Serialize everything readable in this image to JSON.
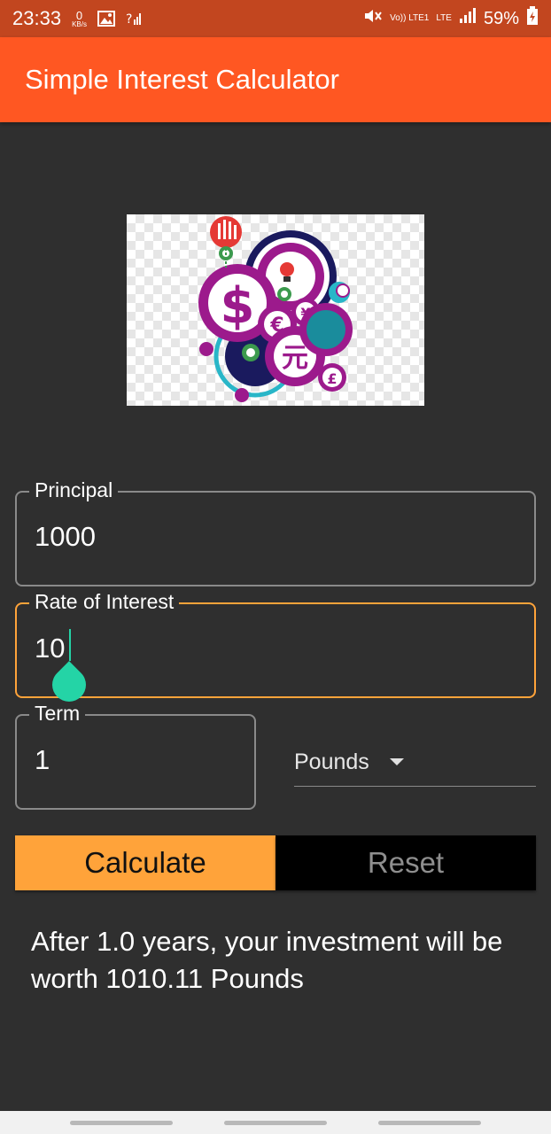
{
  "status_bar": {
    "time": "23:33",
    "speed_value": "0",
    "speed_unit": "KB/s",
    "volte_label": "Vo)) LTE1",
    "lte_label": "LTE",
    "battery_percent": "59%"
  },
  "app_bar": {
    "title": "Simple Interest Calculator"
  },
  "logo": {
    "icon": "finance-gears-currency-logo"
  },
  "principal": {
    "label": "Principal",
    "value": "1000"
  },
  "rate": {
    "label": "Rate of Interest",
    "value": "10"
  },
  "term": {
    "label": "Term",
    "value": "1"
  },
  "currency": {
    "selected": "Pounds"
  },
  "buttons": {
    "calculate": "Calculate",
    "reset": "Reset"
  },
  "result": {
    "text": "After 1.0 years, your investment will be worth 1010.11 Pounds"
  },
  "colors": {
    "accent": "#ff5722",
    "status_bar": "#c2461f",
    "focus": "#ffa33a",
    "cursor_handle": "#24d4a6",
    "background": "#2f2f2f"
  }
}
